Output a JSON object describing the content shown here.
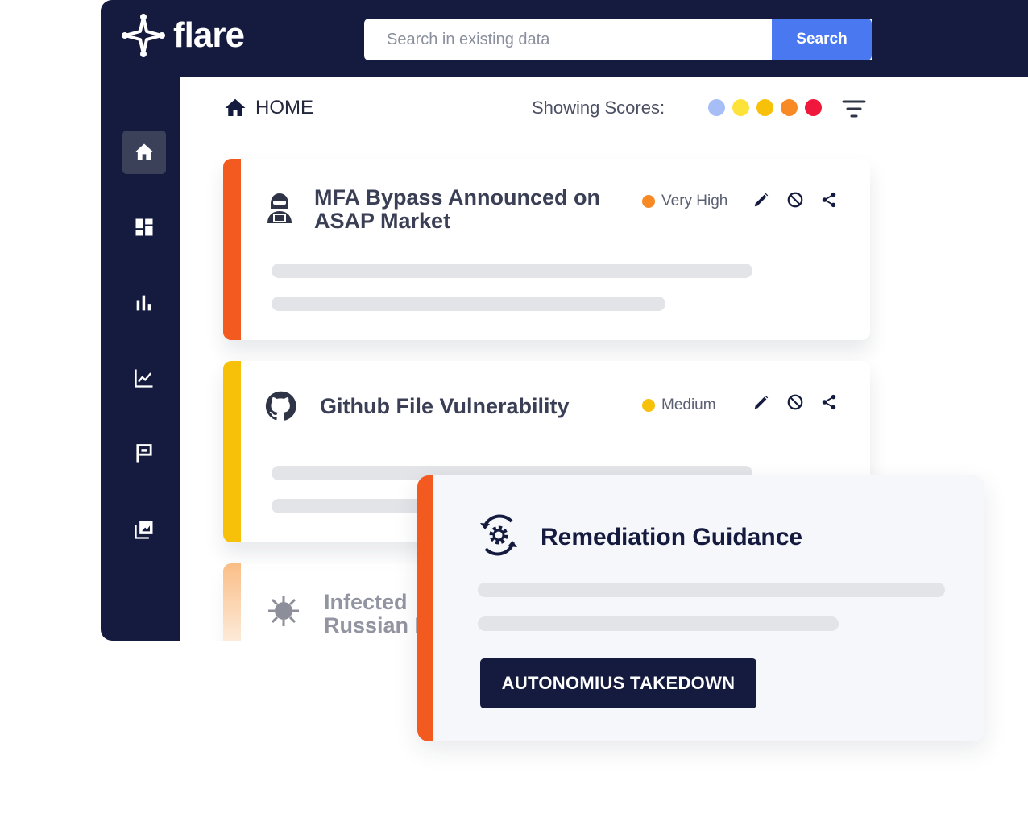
{
  "header": {
    "brand": "flare",
    "search_placeholder": "Search in existing data",
    "search_button": "Search"
  },
  "sidebar": {
    "items": [
      {
        "icon": "home-icon",
        "active": true
      },
      {
        "icon": "dashboard-icon",
        "active": false
      },
      {
        "icon": "bar-chart-icon",
        "active": false
      },
      {
        "icon": "line-chart-icon",
        "active": false
      },
      {
        "icon": "flag-icon",
        "active": false
      },
      {
        "icon": "library-icon",
        "active": false
      }
    ]
  },
  "toolbar": {
    "breadcrumb": "HOME",
    "scores_label": "Showing Scores:",
    "score_colors": [
      "#a7bdf5",
      "#fde23a",
      "#f7c10a",
      "#f78a25",
      "#f0173d"
    ]
  },
  "cards": [
    {
      "title_line1": "MFA Bypass Announced on",
      "title_line2": "ASAP Market",
      "severity": "Very High",
      "severity_color": "#f78a25",
      "stripe_color": "#f25a1f",
      "icon": "hacker-icon"
    },
    {
      "title_line1": "Github File Vulnerability",
      "severity": "Medium",
      "severity_color": "#f7c10a",
      "stripe_color": "#f7c10a",
      "icon": "github-icon"
    },
    {
      "title_line1": "Infected",
      "title_line2": "Russian M",
      "stripe_color": "#f78a25",
      "icon": "virus-icon"
    }
  ],
  "remediation": {
    "title": "Remediation Guidance",
    "button": "AUTONOMIUS TAKEDOWN",
    "icon": "gear-sync-icon"
  }
}
